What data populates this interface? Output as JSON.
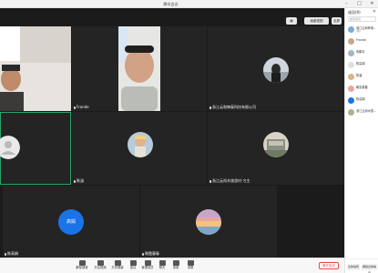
{
  "window": {
    "title": "腾讯会议"
  },
  "stage": {
    "gallery_label": "画廊视图",
    "fullscreen_label": "全屏"
  },
  "tiles": [
    {
      "name": ""
    },
    {
      "name": "Frande"
    },
    {
      "name": "浙江云和锋泰科技有限公司"
    },
    {
      "name": ""
    },
    {
      "name": "陈涵"
    },
    {
      "name": "浙江云尚木旅游村-刁主"
    },
    {
      "name": "陈高娟",
      "avatar_text": "高娟"
    },
    {
      "name": "朝霞暮春"
    }
  ],
  "toolbar": {
    "items": [
      {
        "label": "解除静音",
        "icon": "microphone-icon"
      },
      {
        "label": "开启视频",
        "icon": "camera-icon"
      },
      {
        "label": "共享屏幕",
        "icon": "screen-share-icon"
      },
      {
        "label": "邀请",
        "icon": "invite-icon"
      },
      {
        "label": "管理成员",
        "icon": "members-icon"
      },
      {
        "label": "聊天",
        "icon": "chat-icon"
      },
      {
        "label": "录制",
        "icon": "record-icon"
      },
      {
        "label": "设置",
        "icon": "settings-icon"
      }
    ],
    "leave_label": "离开会议"
  },
  "panel": {
    "title": "成员(9)",
    "search_placeholder": "搜索成员",
    "members": [
      {
        "name": "浙江云和锋泰...",
        "sub": "(我)"
      },
      {
        "name": "Frande",
        "sub": ""
      },
      {
        "name": "朱鹏宇",
        "sub": ""
      },
      {
        "name": "陈高娟",
        "sub": ""
      },
      {
        "name": "陈涵",
        "sub": ""
      },
      {
        "name": "朝霞暮春",
        "sub": ""
      },
      {
        "name": "陈高娟",
        "sub": ""
      },
      {
        "name": "浙江云尚木旅...",
        "sub": ""
      }
    ],
    "mute_all_label": "全体静音",
    "unmute_all_label": "解除全体静音"
  },
  "colors": {
    "accent": "#1a73e8",
    "stage_bg": "#1b1b1b",
    "active_border": "#2aa36b",
    "leave": "#e04a4a"
  }
}
